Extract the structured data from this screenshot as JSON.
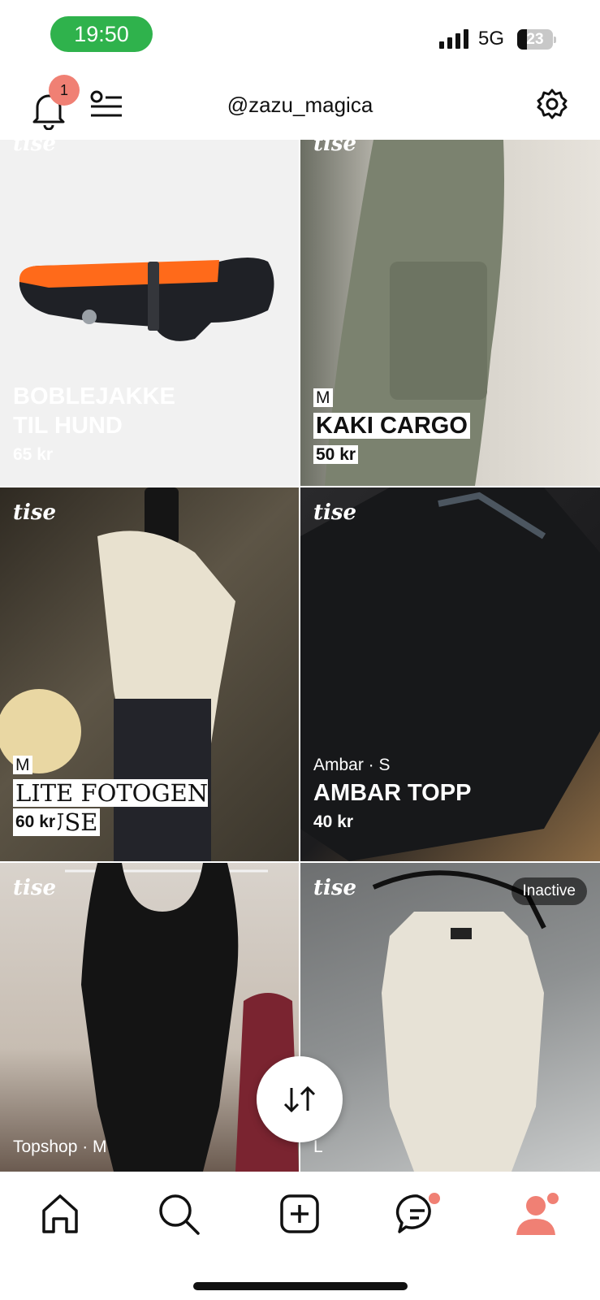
{
  "status_bar": {
    "time": "19:50",
    "network": "5G",
    "battery": "23"
  },
  "header": {
    "notification_count": "1",
    "username": "@zazu_magica"
  },
  "brand": "tise",
  "listings": [
    {
      "meta": "",
      "title_line1": "BOBLEJAKKE",
      "title_line2": "TIL HUND",
      "price": "65 kr"
    },
    {
      "meta": "M",
      "title": "KAKI CARGO",
      "price": "50 kr"
    },
    {
      "meta": "M",
      "title": "LITE FOTOGEN BLUSE",
      "price": "60 kr"
    },
    {
      "meta": "Ambar · S",
      "title": "AMBAR TOPP",
      "price": "40 kr"
    },
    {
      "meta": "Topshop · M",
      "title": "",
      "price": ""
    },
    {
      "meta": "L",
      "title": "",
      "price": "",
      "status": "Inactive"
    }
  ],
  "icons": {
    "notifications": "bell-icon",
    "filters": "list-filter-icon",
    "settings": "gear-icon",
    "sort": "sort-arrows-icon",
    "tabs": [
      "home-icon",
      "search-icon",
      "add-icon",
      "messages-icon",
      "profile-icon"
    ]
  },
  "colors": {
    "status_green": "#2fb24c",
    "accent": "#f08074"
  }
}
